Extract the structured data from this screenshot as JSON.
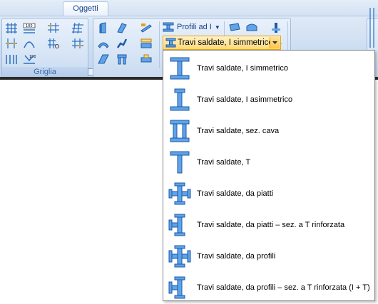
{
  "tabs": {
    "active_label": "Oggetti"
  },
  "ribbon": {
    "group_griglia_label": "Griglia",
    "profili_label": "Profili ad I",
    "combo_value": "Travi saldate, I simmetrico",
    "colors": {
      "accent": "#4a90d9",
      "icon_fill": "#5fa3e8",
      "icon_stroke": "#1f5aa6",
      "highlight": "#ffd978"
    }
  },
  "menu": {
    "items": [
      {
        "label": "Travi saldate, I simmetrico",
        "icon": "i-symmetric-beam-icon"
      },
      {
        "label": "Travi saldate, I asimmetrico",
        "icon": "i-asymmetric-beam-icon"
      },
      {
        "label": "Travi saldate, sez. cava",
        "icon": "hollow-section-beam-icon"
      },
      {
        "label": "Travi saldate, T",
        "icon": "t-beam-icon"
      },
      {
        "label": "Travi saldate, da piatti",
        "icon": "plate-cross-beam-icon"
      },
      {
        "label": "Travi saldate, da piatti – sez. a T rinforzata",
        "icon": "plate-reinforced-t-beam-icon"
      },
      {
        "label": "Travi saldate, da profili",
        "icon": "profile-cross-beam-icon"
      },
      {
        "label": "Travi saldate, da profili – sez. a T rinforzata (I + T)",
        "icon": "profile-reinforced-t-beam-icon"
      }
    ]
  }
}
